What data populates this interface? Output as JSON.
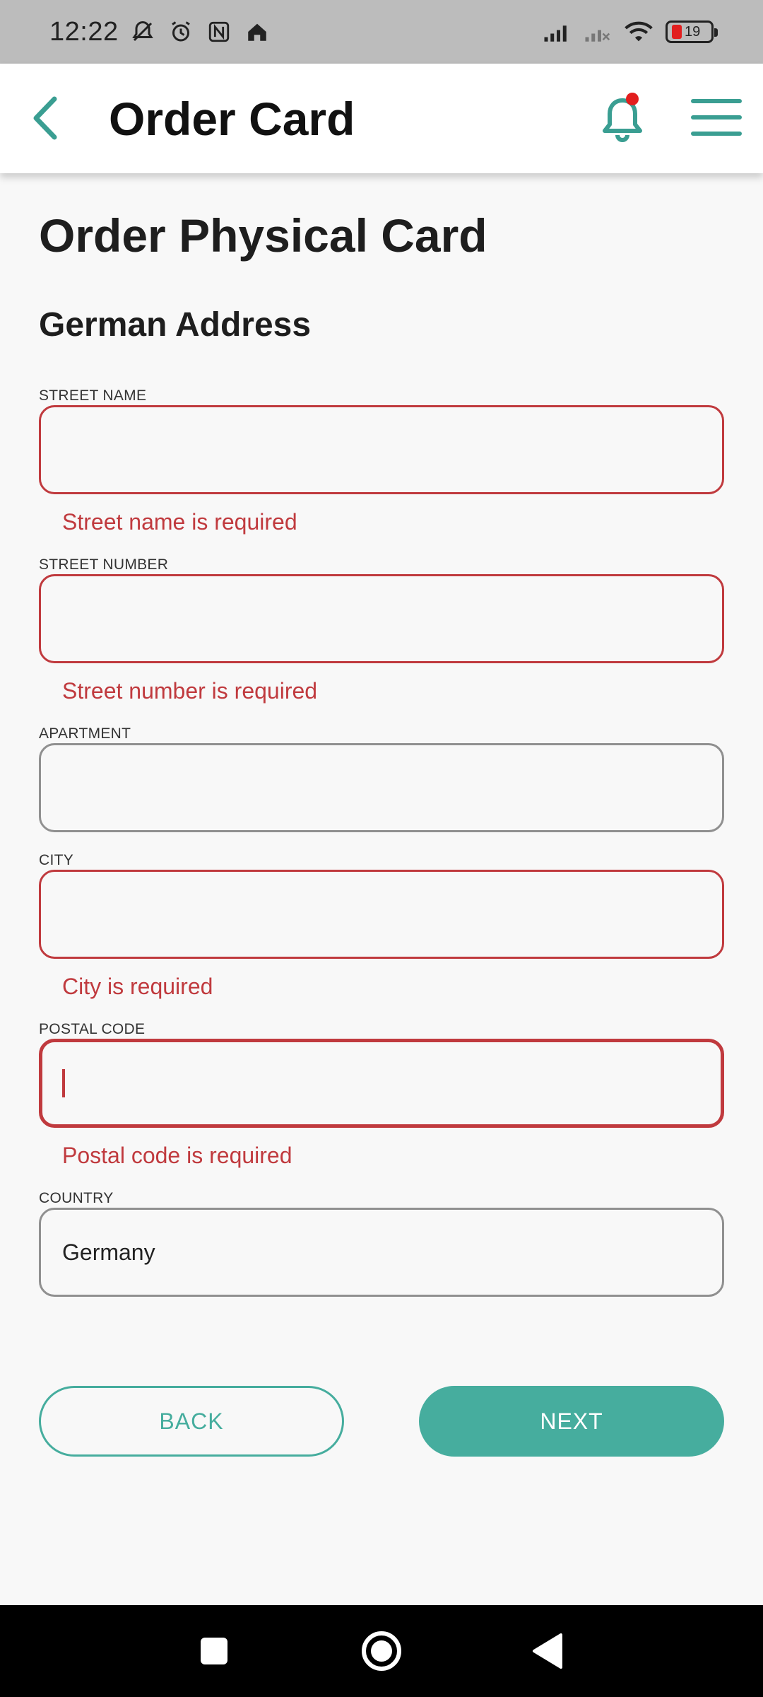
{
  "status_bar": {
    "time": "12:22",
    "icons": [
      "bell-muted-icon",
      "alarm-icon",
      "nfc-icon",
      "home-icon",
      "signal-icon",
      "signal-no-service-icon",
      "wifi-icon"
    ],
    "battery_level": "19",
    "battery_color": "#e21e1e"
  },
  "header": {
    "title": "Order Card",
    "back_icon": "chevron-left-icon",
    "notification_icon": "bell-icon",
    "menu_icon": "hamburger-menu-icon",
    "accent_color": "#3a9e92"
  },
  "page": {
    "title": "Order Physical Card",
    "section_title": "German Address"
  },
  "form": {
    "street_name": {
      "label": "STREET NAME",
      "value": "",
      "error": "Street name is required"
    },
    "street_number": {
      "label": "STREET NUMBER",
      "value": "",
      "error": "Street number is required"
    },
    "apartment": {
      "label": "APARTMENT",
      "value": ""
    },
    "city": {
      "label": "CITY",
      "value": "",
      "error": "City is required"
    },
    "postal_code": {
      "label": "POSTAL CODE",
      "value": "",
      "error": "Postal code is required"
    },
    "country": {
      "label": "COUNTRY",
      "value": "Germany"
    }
  },
  "buttons": {
    "back": "BACK",
    "next": "NEXT"
  },
  "colors": {
    "error": "#c03a3e",
    "primary": "#46ad9e"
  }
}
